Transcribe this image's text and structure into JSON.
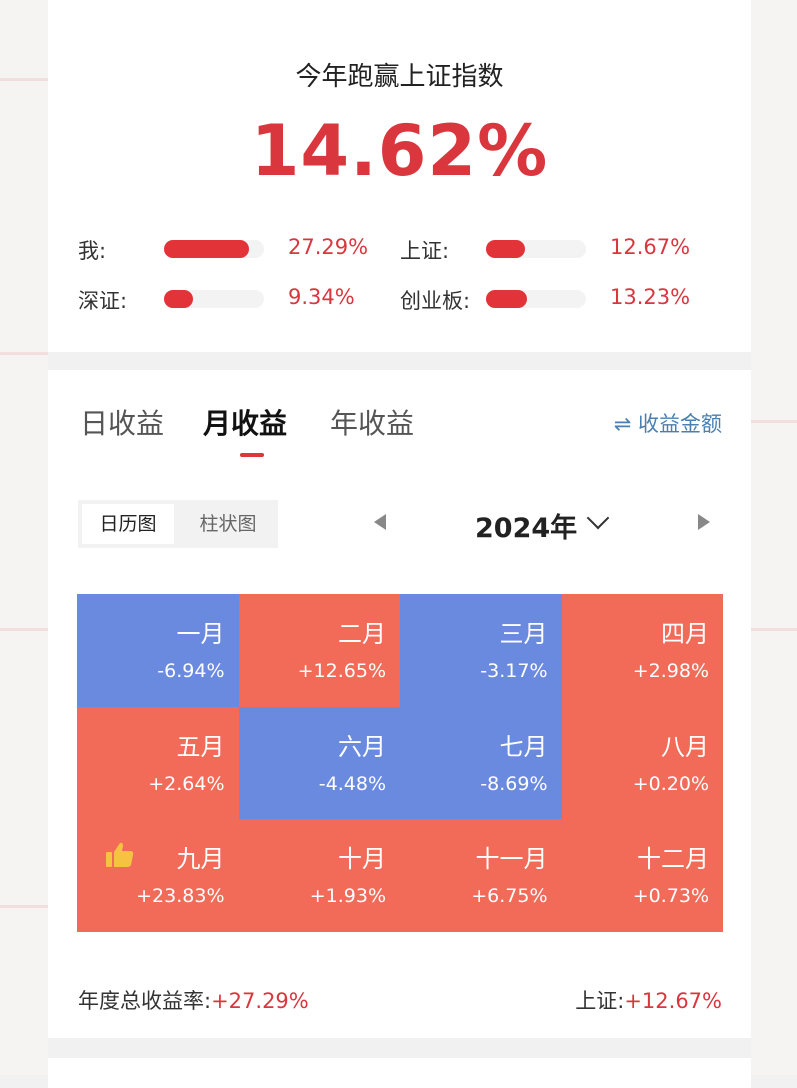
{
  "summary": {
    "headline": "今年跑赢上证指数",
    "outperform_pct": "14.62%",
    "comparisons": [
      {
        "label": "我:",
        "value": "27.29%",
        "level": 0.85
      },
      {
        "label": "上证:",
        "value": "12.67%",
        "level": 0.39
      },
      {
        "label": "深证:",
        "value": "9.34%",
        "level": 0.29
      },
      {
        "label": "创业板:",
        "value": "13.23%",
        "level": 0.41
      }
    ]
  },
  "tabs": [
    {
      "label": "日收益",
      "active": false
    },
    {
      "label": "月收益",
      "active": true
    },
    {
      "label": "年收益",
      "active": false
    }
  ],
  "amount_toggle": {
    "icon": "swap-arrows-icon",
    "label": "收益金额"
  },
  "view_toggle": [
    {
      "label": "日历图",
      "active": true
    },
    {
      "label": "柱状图",
      "active": false
    }
  ],
  "year_selector": {
    "value": "2024年"
  },
  "months": [
    {
      "name": "一月",
      "pct": "-6.94%",
      "sign": "neg"
    },
    {
      "name": "二月",
      "pct": "+12.65%",
      "sign": "pos"
    },
    {
      "name": "三月",
      "pct": "-3.17%",
      "sign": "neg"
    },
    {
      "name": "四月",
      "pct": "+2.98%",
      "sign": "pos"
    },
    {
      "name": "五月",
      "pct": "+2.64%",
      "sign": "pos"
    },
    {
      "name": "六月",
      "pct": "-4.48%",
      "sign": "neg"
    },
    {
      "name": "七月",
      "pct": "-8.69%",
      "sign": "neg"
    },
    {
      "name": "八月",
      "pct": "+0.20%",
      "sign": "pos"
    },
    {
      "name": "九月",
      "pct": "+23.83%",
      "sign": "pos",
      "best": true
    },
    {
      "name": "十月",
      "pct": "+1.93%",
      "sign": "pos"
    },
    {
      "name": "十一月",
      "pct": "+6.75%",
      "sign": "pos"
    },
    {
      "name": "十二月",
      "pct": "+0.73%",
      "sign": "pos"
    }
  ],
  "colors": {
    "positive": "#f26b58",
    "negative": "#6a8ae0",
    "accent": "#d9363e"
  },
  "footer": {
    "annual_label": "年度总收益率:",
    "annual_value": "+27.29%",
    "index_label": "上证:",
    "index_value": "+12.67%"
  }
}
